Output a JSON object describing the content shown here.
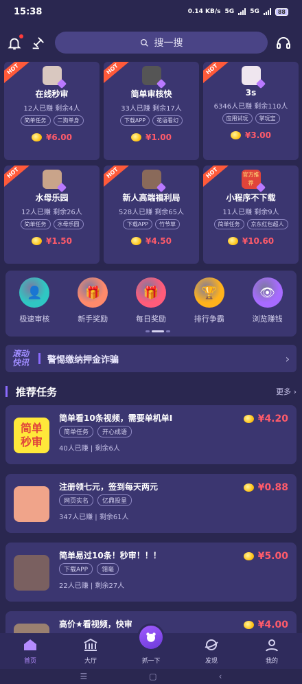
{
  "status": {
    "time": "15:38",
    "speed": "0.14 KB/s",
    "net1": "5G",
    "net2": "5G",
    "battery": "88"
  },
  "search": {
    "label": "搜一搜"
  },
  "grid_cards": [
    {
      "title": "在线秒审",
      "stats": "12人已赚  剩余4人",
      "tags": [
        "简单任务",
        "二狗单身"
      ],
      "price": "¥6.00",
      "badge": "HOT",
      "avatar_color": "#d9c8c0"
    },
    {
      "title": "简单审核快",
      "stats": "33人已赚  剩余17人",
      "tags": [
        "下载APP",
        "花语看幻"
      ],
      "price": "¥1.00",
      "badge": "HOT",
      "avatar_color": "#555555"
    },
    {
      "title": "3s",
      "stats": "6346人已赚  剩余110人",
      "tags": [
        "应用试玩",
        "掌玩宝"
      ],
      "price": "¥3.00",
      "badge": "HOT",
      "avatar_color": "#efe6ef"
    },
    {
      "title": "水母乐园",
      "stats": "12人已赚  剩余26人",
      "tags": [
        "简单任务",
        "水母乐园"
      ],
      "price": "¥1.50",
      "badge": "HOT",
      "avatar_color": "#c9a48a"
    },
    {
      "title": "新人高端福利局",
      "stats": "528人已赚  剩余65人",
      "tags": [
        "下载APP",
        "竹节草"
      ],
      "price": "¥4.50",
      "badge": "HOT",
      "avatar_color": "#8a6a5a"
    },
    {
      "title": "小程序不下载",
      "stats": "11人已赚  剩余9人",
      "tags": [
        "简单任务",
        "京东红包超人"
      ],
      "price": "¥10.60",
      "badge": "HOT",
      "avatar_color": "#e0443a",
      "avatar_text": "官方推荐"
    }
  ],
  "quick_actions": [
    {
      "label": "极速审核",
      "color": "#2fc7c3"
    },
    {
      "label": "新手奖励",
      "color": "#ff8a6b"
    },
    {
      "label": "每日奖励",
      "color": "#ff5c7a"
    },
    {
      "label": "排行争霸",
      "color": "#ffb21c"
    },
    {
      "label": "浏览赚钱",
      "color": "#a76bff"
    }
  ],
  "news": {
    "tag_line1": "滚动",
    "tag_line2": "快讯",
    "text": "警惕缴纳押金诈骗"
  },
  "section": {
    "title": "推荐任务",
    "more": "更多"
  },
  "tasks": [
    {
      "title": "简单看10条视频，需要单机单I",
      "tags": [
        "简单任务",
        "开心成语"
      ],
      "stats": "40人已赚  |  剩余6人",
      "price": "¥4.20",
      "thumb_text": "简单\n秒审",
      "thumb_color": "#ffe83a"
    },
    {
      "title": "注册领七元，签到每天两元",
      "tags": [
        "网页实名",
        "亿鼎投呈"
      ],
      "stats": "347人已赚  |  剩余61人",
      "price": "¥0.88",
      "thumb_color": "#f0a48a"
    },
    {
      "title": "简单易过10条！秒审！！！",
      "tags": [
        "下载APP",
        "翎毫"
      ],
      "stats": "22人已赚  |  剩余27人",
      "price": "¥5.00",
      "thumb_color": "#7a6060"
    },
    {
      "title": "高价★看视频，快审",
      "tags": [],
      "stats": "",
      "price": "¥4.00",
      "thumb_color": "#9a8070"
    }
  ],
  "tabs": [
    {
      "label": "首页"
    },
    {
      "label": "大厅"
    },
    {
      "label": "抓一下"
    },
    {
      "label": "发现"
    },
    {
      "label": "我的"
    }
  ]
}
